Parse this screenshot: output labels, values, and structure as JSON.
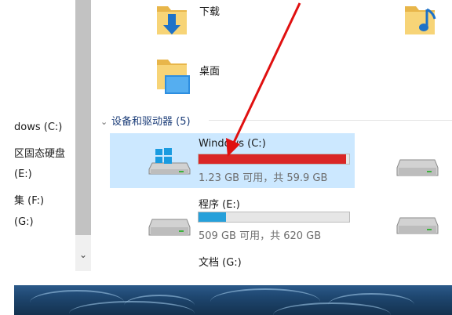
{
  "nav": {
    "items": [
      {
        "label": "dows (C:)"
      },
      {
        "label": "区固态硬盘"
      },
      {
        "label": "(E:)"
      },
      {
        "label": "集 (F:)"
      },
      {
        "label": "(G:)"
      }
    ],
    "scroll_down_glyph": "⌄"
  },
  "folders": {
    "downloads": {
      "label": "下载",
      "icon": "downloads-folder-icon"
    },
    "desktop": {
      "label": "桌面",
      "icon": "desktop-folder-icon"
    },
    "music": {
      "icon": "music-folder-icon"
    }
  },
  "devices_group": {
    "label": "设备和驱动器 (5)",
    "chevron": "⌄"
  },
  "drives": [
    {
      "name": "Windows (C:)",
      "detail": "1.23 GB 可用，共 59.9 GB",
      "used_fraction": 0.979,
      "bar_color": "#da2626",
      "selected": true
    },
    {
      "name": "程序 (E:)",
      "detail": "509 GB 可用，共 620 GB",
      "used_fraction": 0.18,
      "bar_color": "#26a0da",
      "selected": false
    },
    {
      "name": "文档 (G:)",
      "detail": "",
      "used_fraction": 0,
      "bar_color": "#26a0da",
      "selected": false
    }
  ],
  "colors": {
    "selection": "#cce8ff",
    "annotation_arrow": "#e01010",
    "low_space": "#da2626",
    "normal_space": "#26a0da"
  }
}
